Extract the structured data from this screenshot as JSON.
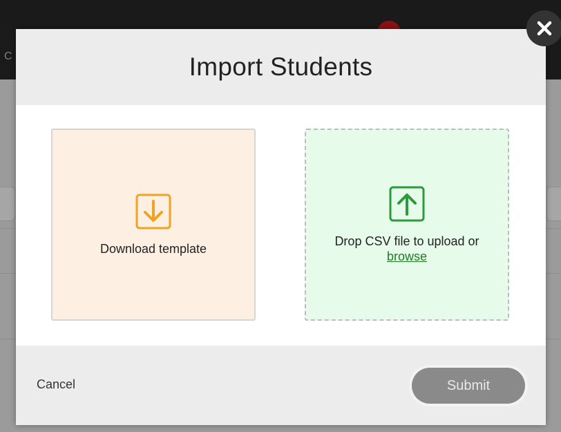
{
  "modal": {
    "title": "Import Students",
    "download_card": {
      "label": "Download template",
      "icon": "download-arrow-icon"
    },
    "upload_card": {
      "label": "Drop CSV file to upload or",
      "link": "browse",
      "icon": "upload-arrow-icon"
    },
    "cancel_label": "Cancel",
    "submit_label": "Submit",
    "close_icon": "close-icon"
  },
  "colors": {
    "download_accent": "#f0a321",
    "upload_accent": "#2a9a3a",
    "link": "#1c7d22",
    "submit_bg": "#8a8a8a"
  }
}
